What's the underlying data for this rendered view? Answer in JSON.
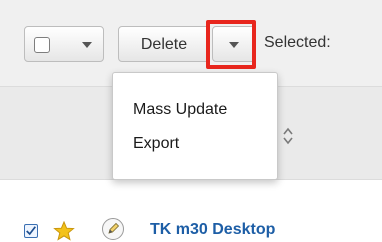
{
  "toolbar": {
    "delete_label": "Delete",
    "selected_label": "Selected:"
  },
  "menu": {
    "items": [
      {
        "label": "Mass Update"
      },
      {
        "label": "Export"
      }
    ]
  },
  "row": {
    "record_name": "TK m30 Desktop"
  },
  "colors": {
    "highlight": "#e8261d",
    "link": "#1d5ea6",
    "star": "#f3c21a"
  },
  "icons": {
    "select_all": "checkbox-icon",
    "caret": "caret-down-icon",
    "sort": "sort-icon",
    "favorite": "star-icon",
    "edit": "pencil-icon"
  }
}
